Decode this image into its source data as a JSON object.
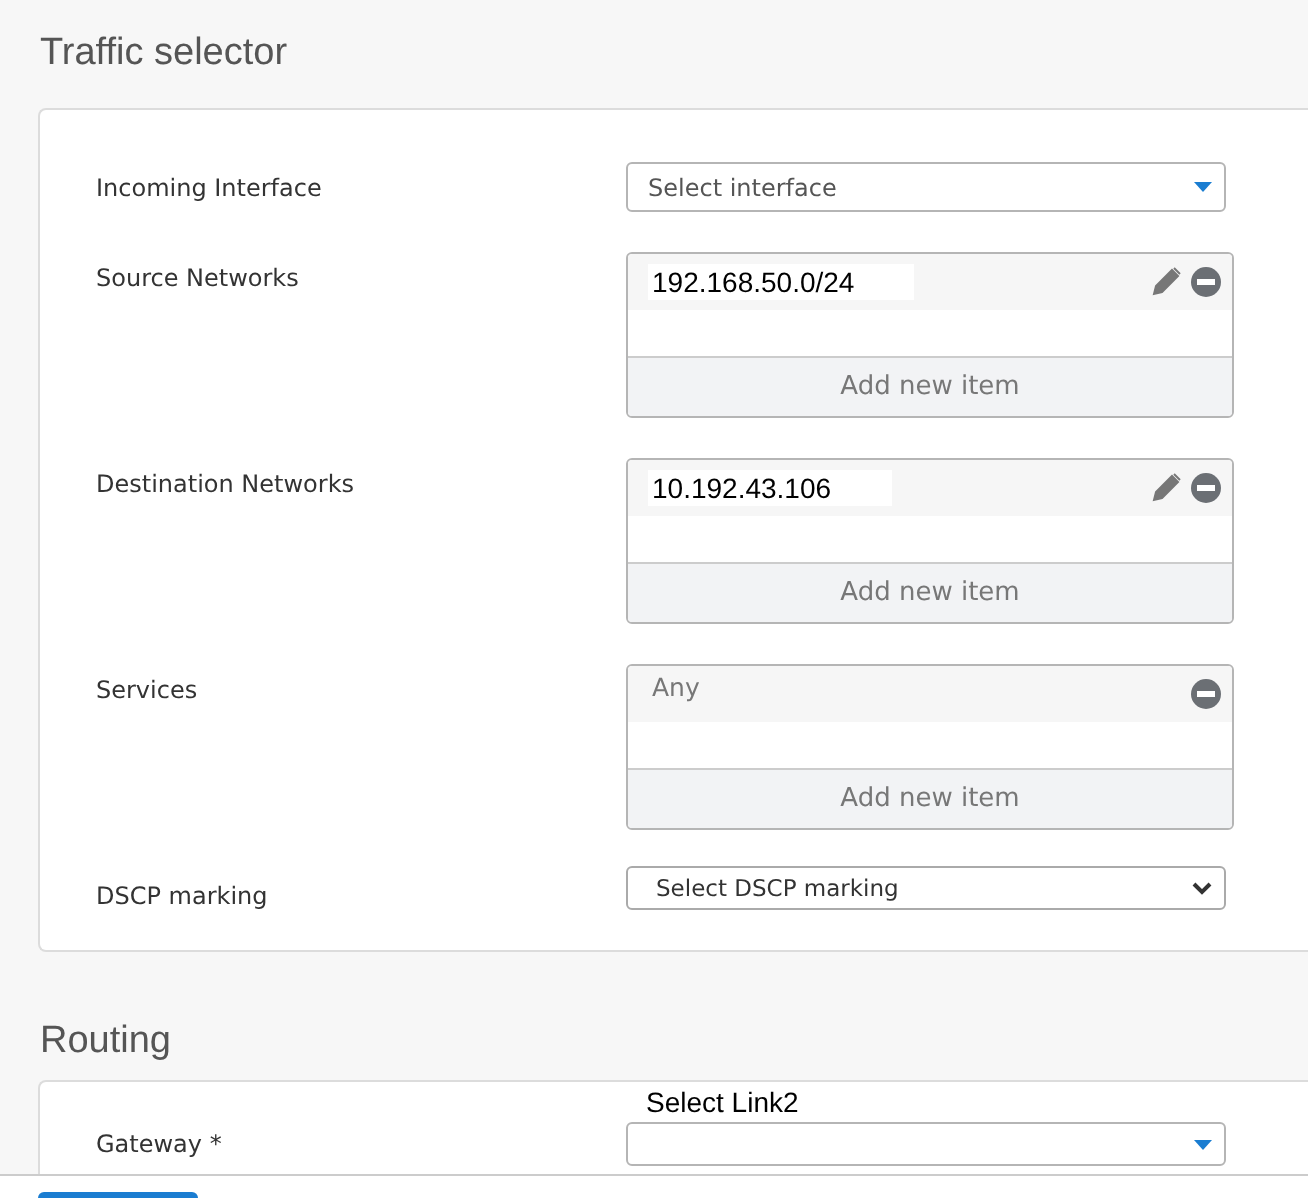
{
  "sections": [
    {
      "title": "Traffic selector",
      "fields": [
        {
          "kind": "dropdown",
          "label": "Incoming Interface",
          "placeholder": "Select interface"
        },
        {
          "kind": "list",
          "label": "Source Networks",
          "items": [
            {
              "value": "192.168.50.0/24",
              "editable": true
            }
          ],
          "add_label": "Add new item"
        },
        {
          "kind": "list",
          "label": "Destination Networks",
          "items": [
            {
              "value": "10.192.43.106",
              "editable": true
            }
          ],
          "add_label": "Add new item"
        },
        {
          "kind": "list",
          "label": "Services",
          "items": [
            {
              "value": "Any",
              "editable": false
            }
          ],
          "add_label": "Add new item"
        },
        {
          "kind": "select",
          "label": "DSCP marking",
          "placeholder": "Select DSCP marking"
        }
      ]
    },
    {
      "title": "Routing",
      "note": "Select Link2",
      "fields": [
        {
          "kind": "dropdown",
          "label": "Gateway *"
        }
      ]
    }
  ]
}
